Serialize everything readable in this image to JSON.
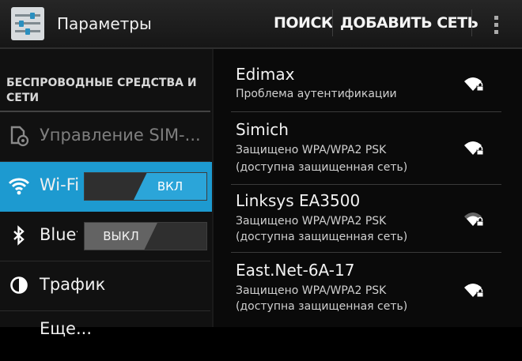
{
  "app": {
    "title": "Параметры",
    "icon": "settings-sliders-icon"
  },
  "actions": {
    "search": "ПОИСК",
    "add_network": "ДОБАВИТЬ СЕТЬ",
    "overflow_icon": "overflow-menu-icon"
  },
  "sidebar": {
    "section_header": "БЕСПРОВОДНЫЕ СРЕДСТВА И СЕТИ",
    "items": [
      {
        "label": "Управление SIM-...",
        "icon": "sim-settings-icon",
        "disabled": true
      },
      {
        "label": "Wi-Fi",
        "icon": "wifi-icon",
        "selected": true,
        "toggle": "ВКЛ",
        "toggle_state": "on"
      },
      {
        "label": "Bluetooth",
        "icon": "bluetooth-icon",
        "toggle": "ВЫКЛ",
        "toggle_state": "off"
      },
      {
        "label": "Трафик",
        "icon": "data-usage-icon"
      },
      {
        "label": "Еще..."
      }
    ]
  },
  "networks": [
    {
      "name": "Edimax",
      "status": [
        "Проблема аутентификации"
      ],
      "signal": "wifi-lock-icon"
    },
    {
      "name": "Simich",
      "status": [
        "Защищено WPA/WPA2 PSK",
        "(доступна защищенная сеть)"
      ],
      "signal": "wifi-lock-icon"
    },
    {
      "name": "Linksys EA3500",
      "status": [
        "Защищено WPA/WPA2 PSK",
        "(доступна защищенная сеть)"
      ],
      "signal": "wifi-lock-icon"
    },
    {
      "name": "East.Net-6A-17",
      "status": [
        "Защищено WPA/WPA2 PSK",
        "(доступна защищенная сеть)"
      ],
      "signal": "wifi-lock-icon"
    }
  ],
  "colors": {
    "accent": "#1d9ad0",
    "toggle_on": "#2ba5d9",
    "toggle_off": "#636363",
    "background": "#000000"
  }
}
